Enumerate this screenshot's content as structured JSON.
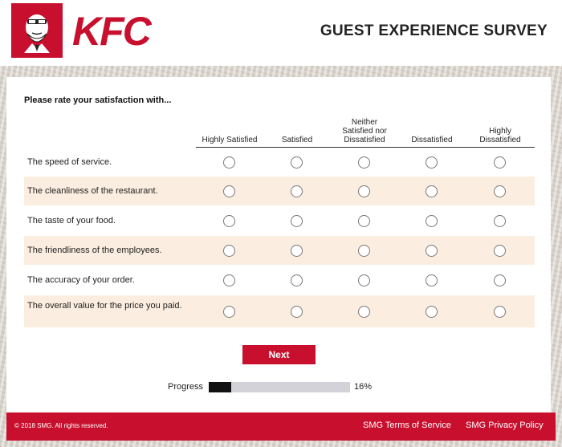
{
  "brand": {
    "name": "KFC",
    "accent": "#c8102e"
  },
  "header": {
    "title": "GUEST EXPERIENCE SURVEY"
  },
  "survey": {
    "prompt": "Please rate your satisfaction with...",
    "columns": [
      "Highly Satisfied",
      "Satisfied",
      "Neither Satisfied nor Dissatisfied",
      "Dissatisfied",
      "Highly Dissatisfied"
    ],
    "columns_lines": [
      [
        "Highly Satisfied"
      ],
      [
        "Satisfied"
      ],
      [
        "Neither",
        "Satisfied nor",
        "Dissatisfied"
      ],
      [
        "Dissatisfied"
      ],
      [
        "Highly",
        "Dissatisfied"
      ]
    ],
    "rows": [
      "The speed of service.",
      "The cleanliness of the restaurant.",
      "The taste of your food.",
      "The friendliness of the employees.",
      "The accuracy of your order.",
      "The overall value for the price you paid."
    ]
  },
  "actions": {
    "next_label": "Next"
  },
  "progress": {
    "label": "Progress",
    "value": 16,
    "text": "16%"
  },
  "footer": {
    "copyright": "© 2018 SMG. All rights reserved.",
    "terms": "SMG Terms of Service",
    "privacy": "SMG Privacy Policy"
  }
}
